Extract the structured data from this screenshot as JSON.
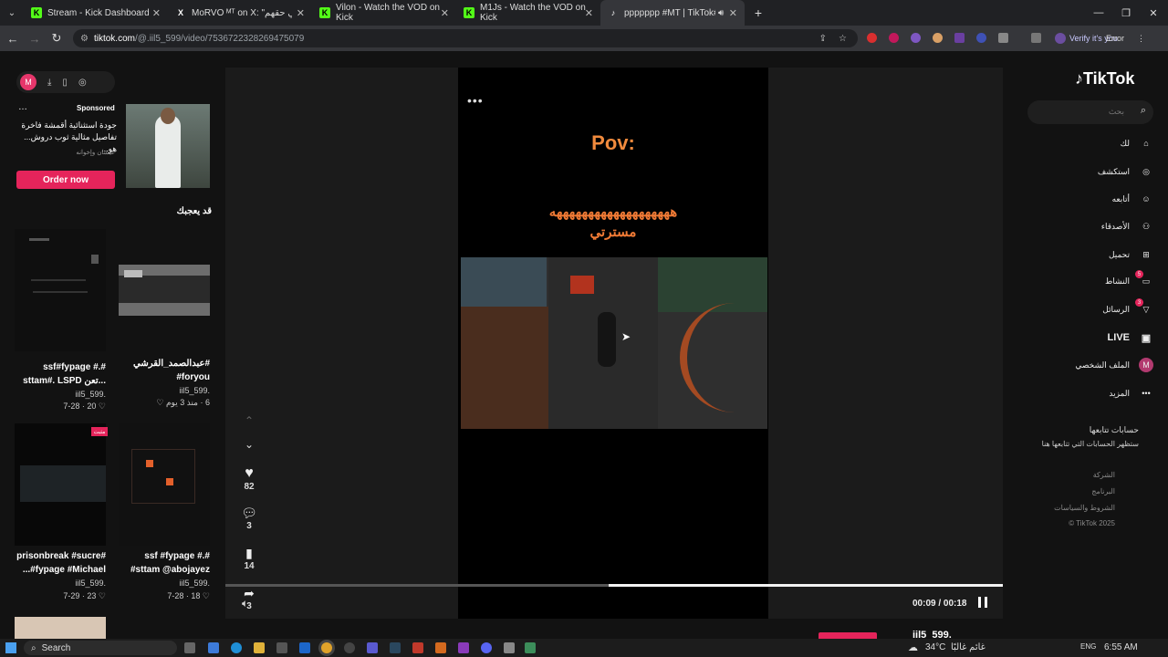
{
  "browser": {
    "tabs": [
      {
        "label": "Stream - Kick Dashboard",
        "icon": "kick-icon"
      },
      {
        "label": "MoRVO ᴹᵀ on X: \"المتنبي حقهم\"",
        "icon": "x-icon"
      },
      {
        "label": "Vilon - Watch the VOD on Kick",
        "icon": "kick-icon"
      },
      {
        "label": "M1Js - Watch the VOD on Kick",
        "icon": "kick-icon"
      },
      {
        "label": "ppppppp #MT | TikTok#(8)",
        "icon": "tiktok-icon",
        "active": true
      }
    ],
    "new_tab": "+",
    "address": {
      "host": "tiktok.com",
      "path": "/@.iil5_599/video/7536722328269475079"
    },
    "verify_label": "Verify it's you",
    "error_label": "Error"
  },
  "left": {
    "ad": {
      "sponsored": "Sponsored",
      "text": "جودة استثنائية أقمشة فاخرة تفاصيل مثالية ثوب دروش... هو...",
      "sub": "عيشان وإخوانه",
      "button": "Order now"
    },
    "section_title": "قد يعجبك",
    "cards": [
      {
        "title": "ssf#fypage #.# sttam#. LSPD تعن...",
        "user": "iil5_599.",
        "meta": "7-28 · 20 ♡"
      },
      {
        "title": "#عبدالصمد_القرشي foryou#",
        "user": "iil5_599.",
        "meta": "6 · منذ 3 يوم ♡"
      },
      {
        "title": "prisonbreak #sucre# ...#fypage #Michael",
        "user": "iil5_599.",
        "meta": "7-29 · 23 ♡",
        "badge": "مثبت"
      },
      {
        "title": "ssf #fypage #.# #sttam @abojayez",
        "user": "iil5_599.",
        "meta": "7-28 · 18 ♡"
      }
    ]
  },
  "video": {
    "pov": "Pov:",
    "laugh": "هههههههههههههههههههه",
    "laugh2": "مسترتي",
    "actions": [
      {
        "icon": "heart-icon",
        "count": "82"
      },
      {
        "icon": "comment-icon",
        "count": "3"
      },
      {
        "icon": "bookmark-icon",
        "count": "14"
      },
      {
        "icon": "share-icon",
        "count": "3"
      }
    ],
    "progress": 0.5,
    "time": "00:09 / 00:18",
    "bottom_user": "iil5_599."
  },
  "right": {
    "logo": "TikTok",
    "search_placeholder": "بحث",
    "nav": [
      {
        "label": "لك",
        "icon": "home-icon"
      },
      {
        "label": "استكشف",
        "icon": "compass-icon"
      },
      {
        "label": "أتابعه",
        "icon": "following-icon"
      },
      {
        "label": "الأصدقاء",
        "icon": "friends-icon"
      },
      {
        "label": "تحميل",
        "icon": "upload-icon"
      },
      {
        "label": "النشاط",
        "icon": "activity-icon",
        "badge": "5"
      },
      {
        "label": "الرسائل",
        "icon": "messages-icon",
        "badge": "3"
      },
      {
        "label": "LIVE",
        "icon": "live-icon"
      },
      {
        "label": "الملف الشخصي",
        "icon": "profile-avatar"
      },
      {
        "label": "المزيد",
        "icon": "more-icon"
      }
    ],
    "follow_title": "حسابات تتابعها",
    "follow_sub": "ستظهر الحسابات التي تتابعها هنا",
    "footer": [
      "الشركة",
      "البرنامج",
      "الشروط والسياسات",
      "© TikTok 2025"
    ]
  },
  "taskbar": {
    "search": "Search",
    "weather": "34°C",
    "weather_desc": "غائم غالبًا",
    "lang": "ENG",
    "clock": "6:55 AM"
  }
}
